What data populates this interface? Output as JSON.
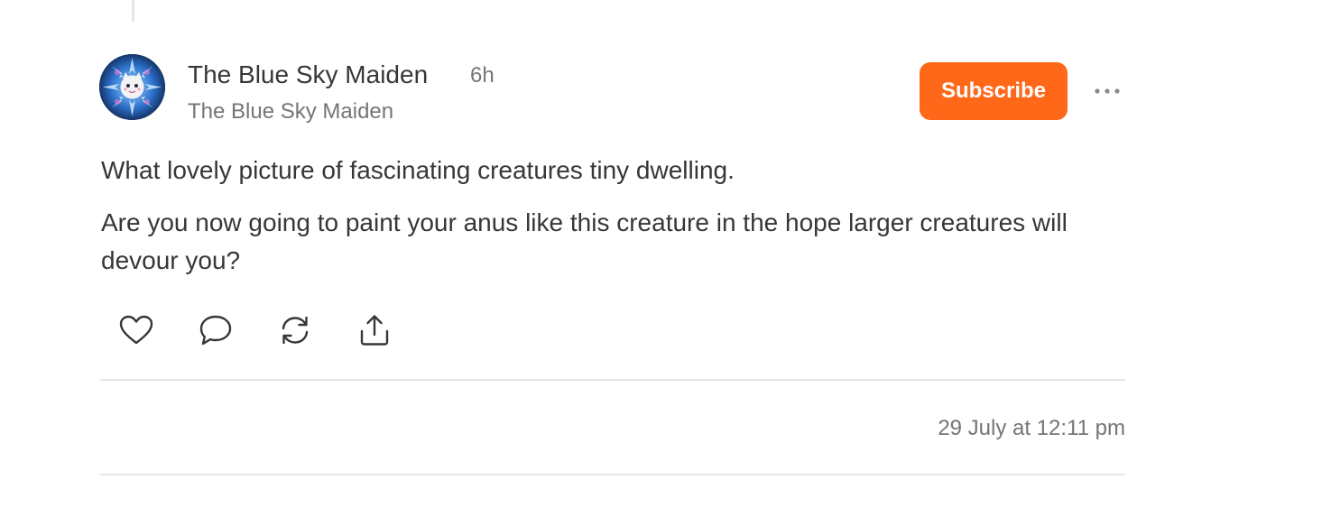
{
  "thread": {
    "author_name": "The Blue Sky Maiden",
    "relative_time": "6h",
    "publication_name": "The Blue Sky Maiden",
    "subscribe_label": "Subscribe",
    "more_icon": "more-horizontal-icon",
    "body": [
      "What lovely picture of fascinating creatures tiny dwelling.",
      "Are you now going to paint your anus like this creature in the hope larger creatures will devour you?"
    ],
    "actions": [
      {
        "icon": "heart-icon"
      },
      {
        "icon": "comment-icon"
      },
      {
        "icon": "restack-icon"
      },
      {
        "icon": "share-icon"
      }
    ],
    "timestamp": "29 July at 12:11 pm"
  },
  "colors": {
    "accent": "#ff6719",
    "text": "#363737",
    "muted": "#757575",
    "divider": "#e6e6e6"
  }
}
